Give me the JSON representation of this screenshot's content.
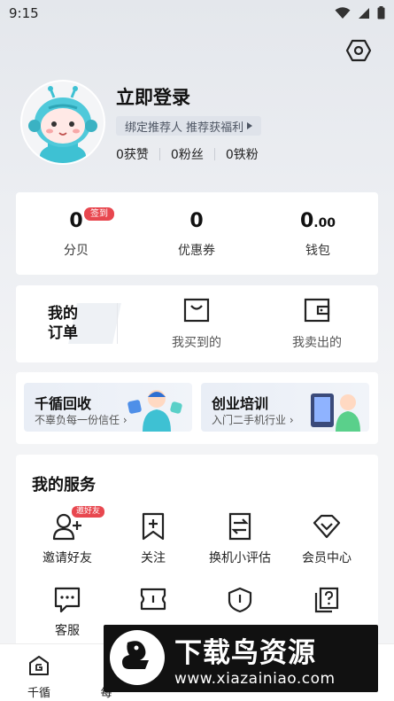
{
  "status_bar": {
    "time": "9:15"
  },
  "profile": {
    "login_title": "立即登录",
    "bind_referrer": "绑定推荐人 推荐获福利",
    "stats": [
      {
        "label": "0获赞"
      },
      {
        "label": "0粉丝"
      },
      {
        "label": "0铁粉"
      }
    ]
  },
  "wallet": {
    "items": [
      {
        "value": "0",
        "label": "分贝"
      },
      {
        "value": "0",
        "label": "优惠券"
      },
      {
        "value_int": "0",
        "value_dec": ".00",
        "label": "钱包"
      }
    ],
    "sign_badge": "签到"
  },
  "orders": {
    "title_line1": "我的",
    "title_line2": "订单",
    "bought": "我买到的",
    "sold": "我卖出的"
  },
  "promos": [
    {
      "title": "千循回收",
      "subtitle": "不辜负每一份信任"
    },
    {
      "title": "创业培训",
      "subtitle": "入门二手机行业"
    }
  ],
  "services": {
    "title": "我的服务",
    "invite_badge": "邀好友",
    "items": [
      {
        "label": "邀请好友",
        "icon": "invite-icon"
      },
      {
        "label": "关注",
        "icon": "bookmark-plus-icon"
      },
      {
        "label": "换机小评估",
        "icon": "swap-icon"
      },
      {
        "label": "会员中心",
        "icon": "diamond-icon"
      },
      {
        "label": "客服",
        "icon": "chat-icon"
      },
      {
        "label": "",
        "icon": "ticket-icon"
      },
      {
        "label": "",
        "icon": "shield-icon"
      },
      {
        "label": "",
        "icon": "help-icon"
      }
    ]
  },
  "tabbar": {
    "items": [
      {
        "label": "千循",
        "icon": "home-icon"
      },
      {
        "label": "每",
        "icon": "tab-icon"
      }
    ]
  },
  "watermark": {
    "title": "下载鸟资源",
    "url": "www.xiazainiao.com"
  },
  "colors": {
    "accent_red": "#e8474f",
    "text_dark": "#111111",
    "card_bg": "#ffffff"
  }
}
